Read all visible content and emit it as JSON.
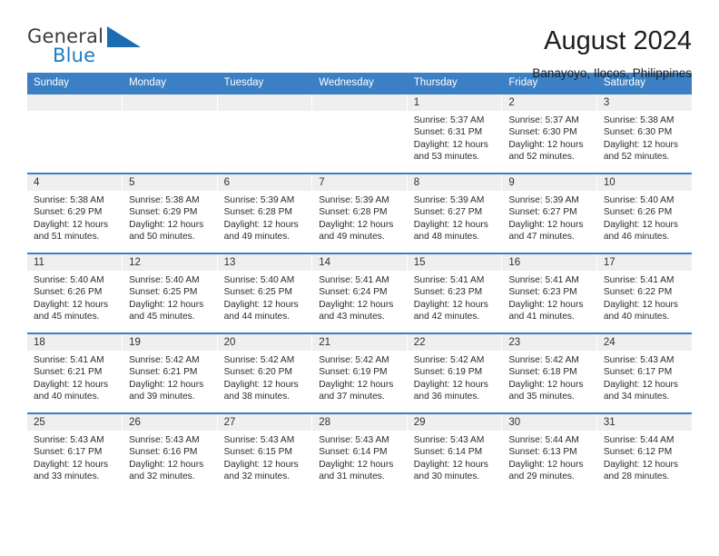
{
  "brand": {
    "word_one": "General",
    "word_two": "Blue",
    "accent_color": "#1d7cc4",
    "triangle_color": "#1b6cb0"
  },
  "header": {
    "month_title": "August 2024",
    "location": "Banayoyo, Ilocos, Philippines",
    "header_bg": "#3b7fc4"
  },
  "weekday_headers": [
    "Sunday",
    "Monday",
    "Tuesday",
    "Wednesday",
    "Thursday",
    "Friday",
    "Saturday"
  ],
  "weeks": [
    [
      {
        "day": "",
        "sunrise": "",
        "sunset": "",
        "daylight": "",
        "daylight2": "",
        "empty": true
      },
      {
        "day": "",
        "sunrise": "",
        "sunset": "",
        "daylight": "",
        "daylight2": "",
        "empty": true
      },
      {
        "day": "",
        "sunrise": "",
        "sunset": "",
        "daylight": "",
        "daylight2": "",
        "empty": true
      },
      {
        "day": "",
        "sunrise": "",
        "sunset": "",
        "daylight": "",
        "daylight2": "",
        "empty": true
      },
      {
        "day": "1",
        "sunrise": "Sunrise: 5:37 AM",
        "sunset": "Sunset: 6:31 PM",
        "daylight": "Daylight: 12 hours",
        "daylight2": "and 53 minutes."
      },
      {
        "day": "2",
        "sunrise": "Sunrise: 5:37 AM",
        "sunset": "Sunset: 6:30 PM",
        "daylight": "Daylight: 12 hours",
        "daylight2": "and 52 minutes."
      },
      {
        "day": "3",
        "sunrise": "Sunrise: 5:38 AM",
        "sunset": "Sunset: 6:30 PM",
        "daylight": "Daylight: 12 hours",
        "daylight2": "and 52 minutes."
      }
    ],
    [
      {
        "day": "4",
        "sunrise": "Sunrise: 5:38 AM",
        "sunset": "Sunset: 6:29 PM",
        "daylight": "Daylight: 12 hours",
        "daylight2": "and 51 minutes."
      },
      {
        "day": "5",
        "sunrise": "Sunrise: 5:38 AM",
        "sunset": "Sunset: 6:29 PM",
        "daylight": "Daylight: 12 hours",
        "daylight2": "and 50 minutes."
      },
      {
        "day": "6",
        "sunrise": "Sunrise: 5:39 AM",
        "sunset": "Sunset: 6:28 PM",
        "daylight": "Daylight: 12 hours",
        "daylight2": "and 49 minutes."
      },
      {
        "day": "7",
        "sunrise": "Sunrise: 5:39 AM",
        "sunset": "Sunset: 6:28 PM",
        "daylight": "Daylight: 12 hours",
        "daylight2": "and 49 minutes."
      },
      {
        "day": "8",
        "sunrise": "Sunrise: 5:39 AM",
        "sunset": "Sunset: 6:27 PM",
        "daylight": "Daylight: 12 hours",
        "daylight2": "and 48 minutes."
      },
      {
        "day": "9",
        "sunrise": "Sunrise: 5:39 AM",
        "sunset": "Sunset: 6:27 PM",
        "daylight": "Daylight: 12 hours",
        "daylight2": "and 47 minutes."
      },
      {
        "day": "10",
        "sunrise": "Sunrise: 5:40 AM",
        "sunset": "Sunset: 6:26 PM",
        "daylight": "Daylight: 12 hours",
        "daylight2": "and 46 minutes."
      }
    ],
    [
      {
        "day": "11",
        "sunrise": "Sunrise: 5:40 AM",
        "sunset": "Sunset: 6:26 PM",
        "daylight": "Daylight: 12 hours",
        "daylight2": "and 45 minutes."
      },
      {
        "day": "12",
        "sunrise": "Sunrise: 5:40 AM",
        "sunset": "Sunset: 6:25 PM",
        "daylight": "Daylight: 12 hours",
        "daylight2": "and 45 minutes."
      },
      {
        "day": "13",
        "sunrise": "Sunrise: 5:40 AM",
        "sunset": "Sunset: 6:25 PM",
        "daylight": "Daylight: 12 hours",
        "daylight2": "and 44 minutes."
      },
      {
        "day": "14",
        "sunrise": "Sunrise: 5:41 AM",
        "sunset": "Sunset: 6:24 PM",
        "daylight": "Daylight: 12 hours",
        "daylight2": "and 43 minutes."
      },
      {
        "day": "15",
        "sunrise": "Sunrise: 5:41 AM",
        "sunset": "Sunset: 6:23 PM",
        "daylight": "Daylight: 12 hours",
        "daylight2": "and 42 minutes."
      },
      {
        "day": "16",
        "sunrise": "Sunrise: 5:41 AM",
        "sunset": "Sunset: 6:23 PM",
        "daylight": "Daylight: 12 hours",
        "daylight2": "and 41 minutes."
      },
      {
        "day": "17",
        "sunrise": "Sunrise: 5:41 AM",
        "sunset": "Sunset: 6:22 PM",
        "daylight": "Daylight: 12 hours",
        "daylight2": "and 40 minutes."
      }
    ],
    [
      {
        "day": "18",
        "sunrise": "Sunrise: 5:41 AM",
        "sunset": "Sunset: 6:21 PM",
        "daylight": "Daylight: 12 hours",
        "daylight2": "and 40 minutes."
      },
      {
        "day": "19",
        "sunrise": "Sunrise: 5:42 AM",
        "sunset": "Sunset: 6:21 PM",
        "daylight": "Daylight: 12 hours",
        "daylight2": "and 39 minutes."
      },
      {
        "day": "20",
        "sunrise": "Sunrise: 5:42 AM",
        "sunset": "Sunset: 6:20 PM",
        "daylight": "Daylight: 12 hours",
        "daylight2": "and 38 minutes."
      },
      {
        "day": "21",
        "sunrise": "Sunrise: 5:42 AM",
        "sunset": "Sunset: 6:19 PM",
        "daylight": "Daylight: 12 hours",
        "daylight2": "and 37 minutes."
      },
      {
        "day": "22",
        "sunrise": "Sunrise: 5:42 AM",
        "sunset": "Sunset: 6:19 PM",
        "daylight": "Daylight: 12 hours",
        "daylight2": "and 36 minutes."
      },
      {
        "day": "23",
        "sunrise": "Sunrise: 5:42 AM",
        "sunset": "Sunset: 6:18 PM",
        "daylight": "Daylight: 12 hours",
        "daylight2": "and 35 minutes."
      },
      {
        "day": "24",
        "sunrise": "Sunrise: 5:43 AM",
        "sunset": "Sunset: 6:17 PM",
        "daylight": "Daylight: 12 hours",
        "daylight2": "and 34 minutes."
      }
    ],
    [
      {
        "day": "25",
        "sunrise": "Sunrise: 5:43 AM",
        "sunset": "Sunset: 6:17 PM",
        "daylight": "Daylight: 12 hours",
        "daylight2": "and 33 minutes."
      },
      {
        "day": "26",
        "sunrise": "Sunrise: 5:43 AM",
        "sunset": "Sunset: 6:16 PM",
        "daylight": "Daylight: 12 hours",
        "daylight2": "and 32 minutes."
      },
      {
        "day": "27",
        "sunrise": "Sunrise: 5:43 AM",
        "sunset": "Sunset: 6:15 PM",
        "daylight": "Daylight: 12 hours",
        "daylight2": "and 32 minutes."
      },
      {
        "day": "28",
        "sunrise": "Sunrise: 5:43 AM",
        "sunset": "Sunset: 6:14 PM",
        "daylight": "Daylight: 12 hours",
        "daylight2": "and 31 minutes."
      },
      {
        "day": "29",
        "sunrise": "Sunrise: 5:43 AM",
        "sunset": "Sunset: 6:14 PM",
        "daylight": "Daylight: 12 hours",
        "daylight2": "and 30 minutes."
      },
      {
        "day": "30",
        "sunrise": "Sunrise: 5:44 AM",
        "sunset": "Sunset: 6:13 PM",
        "daylight": "Daylight: 12 hours",
        "daylight2": "and 29 minutes."
      },
      {
        "day": "31",
        "sunrise": "Sunrise: 5:44 AM",
        "sunset": "Sunset: 6:12 PM",
        "daylight": "Daylight: 12 hours",
        "daylight2": "and 28 minutes."
      }
    ]
  ]
}
